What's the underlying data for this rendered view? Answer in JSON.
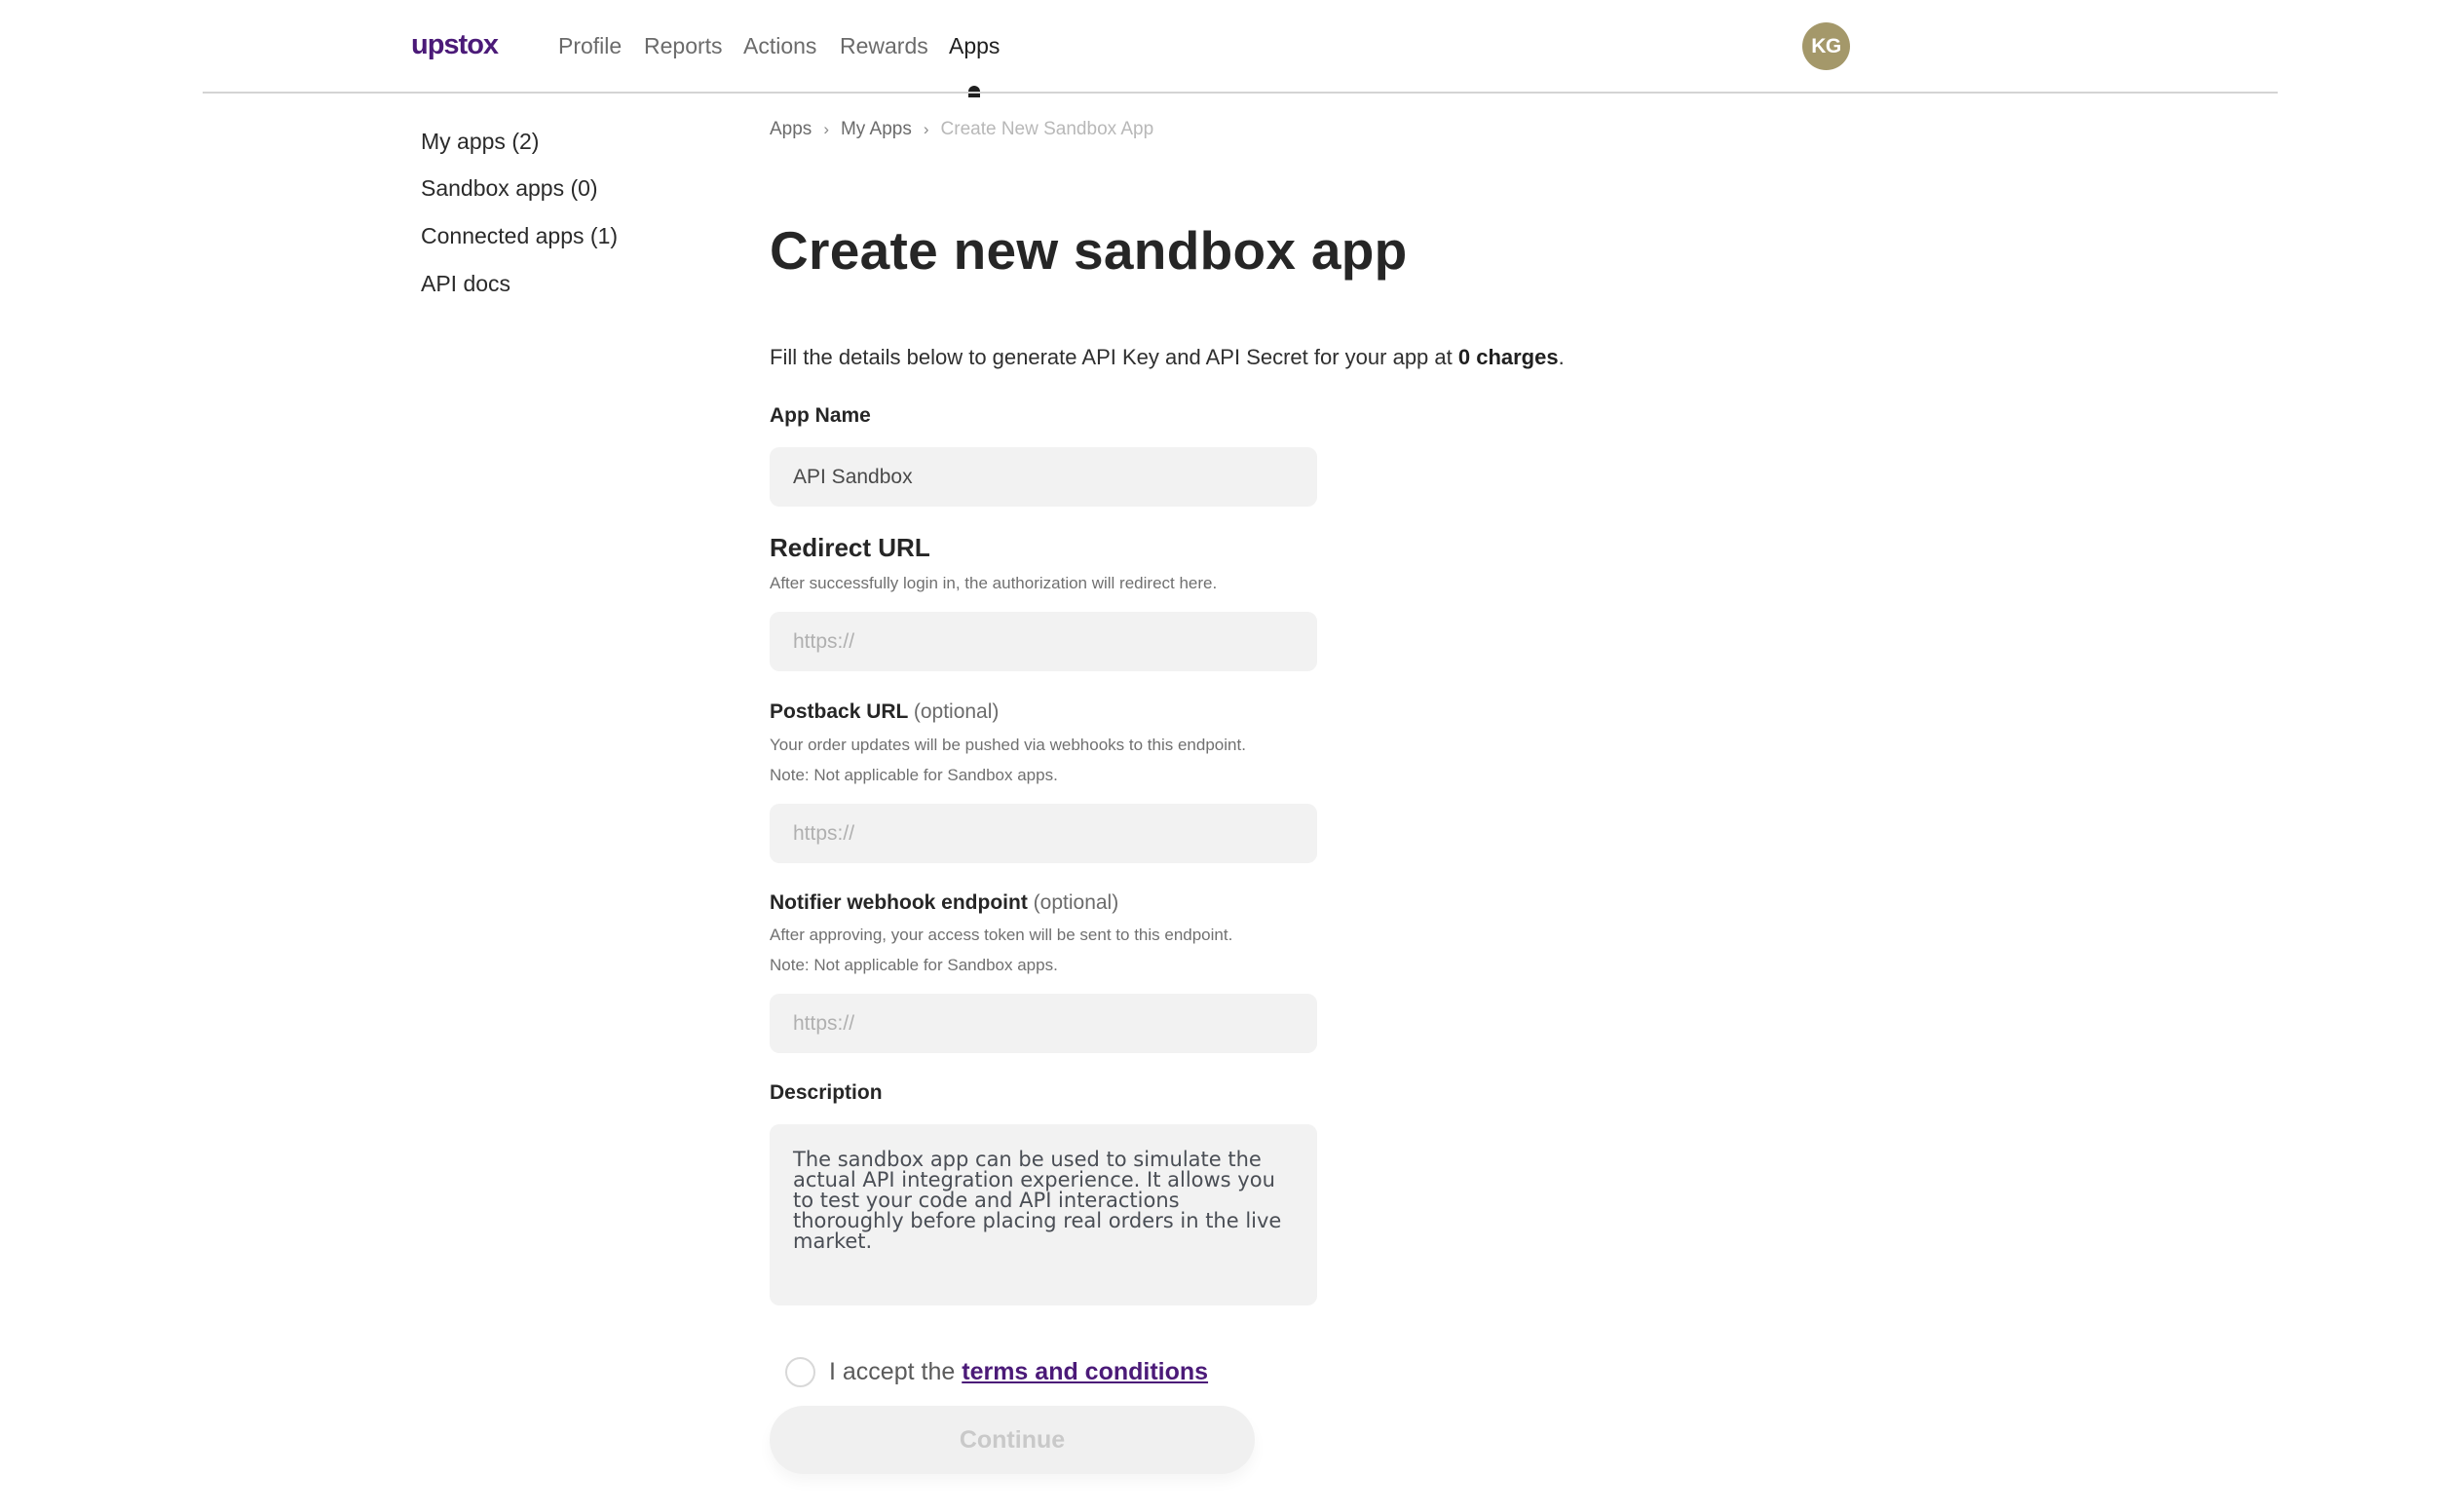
{
  "brand": {
    "logo_text": "upstox",
    "logo_color": "#4b1a78"
  },
  "nav": {
    "items": [
      {
        "label": "Profile",
        "active": false
      },
      {
        "label": "Reports",
        "active": false
      },
      {
        "label": "Actions",
        "active": false
      },
      {
        "label": "Rewards",
        "active": false
      },
      {
        "label": "Apps",
        "active": true
      }
    ]
  },
  "user": {
    "initials": "KG",
    "avatar_color": "#a4986a"
  },
  "sidebar": {
    "items": [
      {
        "label": "My apps (2)"
      },
      {
        "label": "Sandbox apps (0)"
      },
      {
        "label": "Connected apps (1)"
      },
      {
        "label": "API docs"
      }
    ]
  },
  "breadcrumb": {
    "items": [
      {
        "label": "Apps"
      },
      {
        "label": "My Apps"
      },
      {
        "label": "Create New Sandbox App"
      }
    ],
    "separator": "›"
  },
  "page": {
    "title": "Create new sandbox app",
    "intro_prefix": "Fill the details below to generate API Key and API Secret for your app at ",
    "intro_bold": "0 charges",
    "intro_suffix": "."
  },
  "form": {
    "app_name": {
      "label": "App Name",
      "value": "API Sandbox"
    },
    "redirect_url": {
      "label": "Redirect URL",
      "helper": "After successfully login in, the authorization will redirect here.",
      "placeholder": "https://",
      "value": ""
    },
    "postback_url": {
      "label": "Postback URL",
      "optional": "(optional)",
      "helper": "Your order updates will be pushed via webhooks to this endpoint.",
      "note": "Note: Not applicable for Sandbox apps.",
      "placeholder": "https://",
      "value": ""
    },
    "notifier_webhook": {
      "label": "Notifier webhook endpoint",
      "optional": "(optional)",
      "helper": "After approving, your access token will be sent to this endpoint.",
      "note": "Note: Not applicable for Sandbox apps.",
      "placeholder": "https://",
      "value": ""
    },
    "description": {
      "label": "Description",
      "value": "The sandbox app can be used to simulate the actual API integration experience. It allows you to test your code and API interactions thoroughly before placing real orders in the live market."
    },
    "accept": {
      "prefix": "I accept the",
      "link_label": "terms and conditions",
      "checked": false,
      "link_color": "#4b1a78"
    },
    "continue_label": "Continue",
    "continue_enabled": false
  }
}
